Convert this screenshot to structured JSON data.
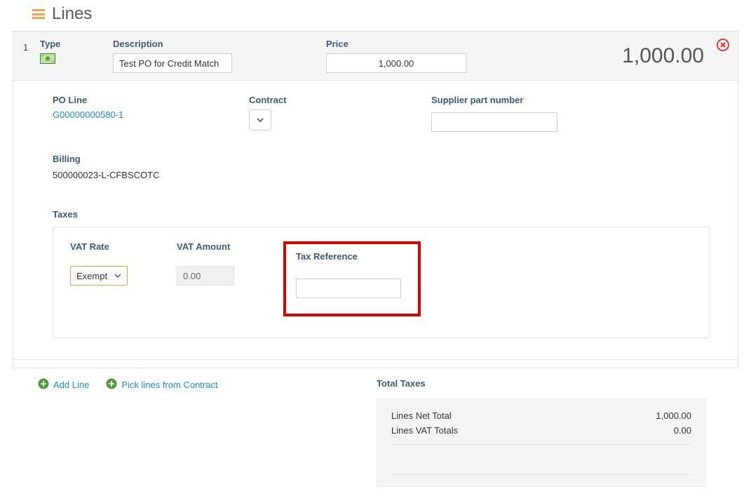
{
  "section": {
    "title": "Lines"
  },
  "line": {
    "number": "1",
    "type_label": "Type",
    "description_label": "Description",
    "description_value": "Test PO for Credit Match",
    "price_label": "Price",
    "price_value": "1,000.00",
    "line_total": "1,000.00"
  },
  "detail": {
    "po_line_label": "PO Line",
    "po_line_value": "G00000000580-1",
    "contract_label": "Contract",
    "supplier_part_label": "Supplier part number",
    "supplier_part_value": "",
    "billing_label": "Billing",
    "billing_value": "500000023-L-CFBSCOTC",
    "taxes_label": "Taxes",
    "vat_rate_label": "VAT Rate",
    "vat_rate_value": "Exempt",
    "vat_amount_label": "VAT Amount",
    "vat_amount_value": "0.00",
    "tax_reference_label": "Tax Reference",
    "tax_reference_value": ""
  },
  "actions": {
    "add_line": "Add Line",
    "pick_lines": "Pick lines from Contract"
  },
  "totals": {
    "title": "Total Taxes",
    "net_label": "Lines Net Total",
    "net_value": "1,000.00",
    "vat_label": "Lines VAT Totals",
    "vat_value": "0.00"
  }
}
